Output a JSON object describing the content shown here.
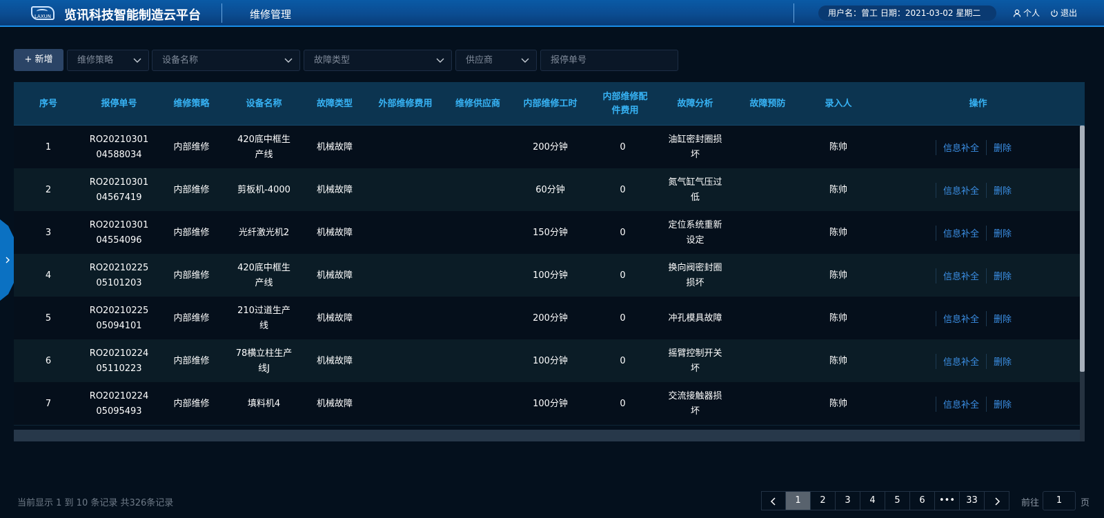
{
  "header": {
    "logo_text": "LAXUN",
    "app_title": "览讯科技智能制造云平台",
    "module_title": "维修管理",
    "user_info": "用户名：曾工   日期：2021-03-02   星期二",
    "personal_label": "个人",
    "logout_label": "退出"
  },
  "toolbar": {
    "add_label": "+ 新增",
    "filters": [
      {
        "placeholder": "维修策略"
      },
      {
        "placeholder": "设备名称"
      },
      {
        "placeholder": "故障类型"
      },
      {
        "placeholder": "供应商"
      }
    ],
    "order_no_placeholder": "报停单号"
  },
  "table": {
    "columns": [
      "序号",
      "报停单号",
      "维修策略",
      "设备名称",
      "故障类型",
      "外部维修费用",
      "维修供应商",
      "内部维修工时",
      "内部维修配件费用",
      "故障分析",
      "故障预防",
      "录入人",
      "操作"
    ],
    "rows": [
      {
        "no": "1",
        "order": "RO2021030104588034",
        "strategy": "内部维修",
        "device": "420底中框生产线",
        "fault": "机械故障",
        "ext_cost": "",
        "supplier": "",
        "hours": "200分钟",
        "parts_cost": "0",
        "analysis": "油缸密封圈损坏",
        "prevention": "",
        "recorder": "陈帅"
      },
      {
        "no": "2",
        "order": "RO2021030104567419",
        "strategy": "内部维修",
        "device": "剪板机-4000",
        "fault": "机械故障",
        "ext_cost": "",
        "supplier": "",
        "hours": "60分钟",
        "parts_cost": "0",
        "analysis": "氮气缸气压过低",
        "prevention": "",
        "recorder": "陈帅"
      },
      {
        "no": "3",
        "order": "RO2021030104554096",
        "strategy": "内部维修",
        "device": "光纤激光机2",
        "fault": "机械故障",
        "ext_cost": "",
        "supplier": "",
        "hours": "150分钟",
        "parts_cost": "0",
        "analysis": "定位系统重新设定",
        "prevention": "",
        "recorder": "陈帅"
      },
      {
        "no": "4",
        "order": "RO2021022505101203",
        "strategy": "内部维修",
        "device": "420底中框生产线",
        "fault": "机械故障",
        "ext_cost": "",
        "supplier": "",
        "hours": "100分钟",
        "parts_cost": "0",
        "analysis": "换向阀密封圈损坏",
        "prevention": "",
        "recorder": "陈帅"
      },
      {
        "no": "5",
        "order": "RO2021022505094101",
        "strategy": "内部维修",
        "device": "210过道生产线",
        "fault": "机械故障",
        "ext_cost": "",
        "supplier": "",
        "hours": "200分钟",
        "parts_cost": "0",
        "analysis": "冲孔模具故障",
        "prevention": "",
        "recorder": "陈帅"
      },
      {
        "no": "6",
        "order": "RO2021022405110223",
        "strategy": "内部维修",
        "device": "78横立柱生产线J",
        "fault": "机械故障",
        "ext_cost": "",
        "supplier": "",
        "hours": "100分钟",
        "parts_cost": "0",
        "analysis": "摇臂控制开关坏",
        "prevention": "",
        "recorder": "陈帅"
      },
      {
        "no": "7",
        "order": "RO2021022405095493",
        "strategy": "内部维修",
        "device": "填料机4",
        "fault": "机械故障",
        "ext_cost": "",
        "supplier": "",
        "hours": "100分钟",
        "parts_cost": "0",
        "analysis": "交流接触器损坏",
        "prevention": "",
        "recorder": "陈帅"
      }
    ],
    "actions": {
      "supplement": "信息补全",
      "delete": "删除"
    }
  },
  "footer": {
    "summary": "当前显示 1 到 10 条记录 共326条记录",
    "pages": [
      "1",
      "2",
      "3",
      "4",
      "5",
      "6",
      "•••",
      "33"
    ],
    "current_page": "1",
    "goto_label": "前往",
    "goto_value": "1",
    "page_unit": "页"
  }
}
